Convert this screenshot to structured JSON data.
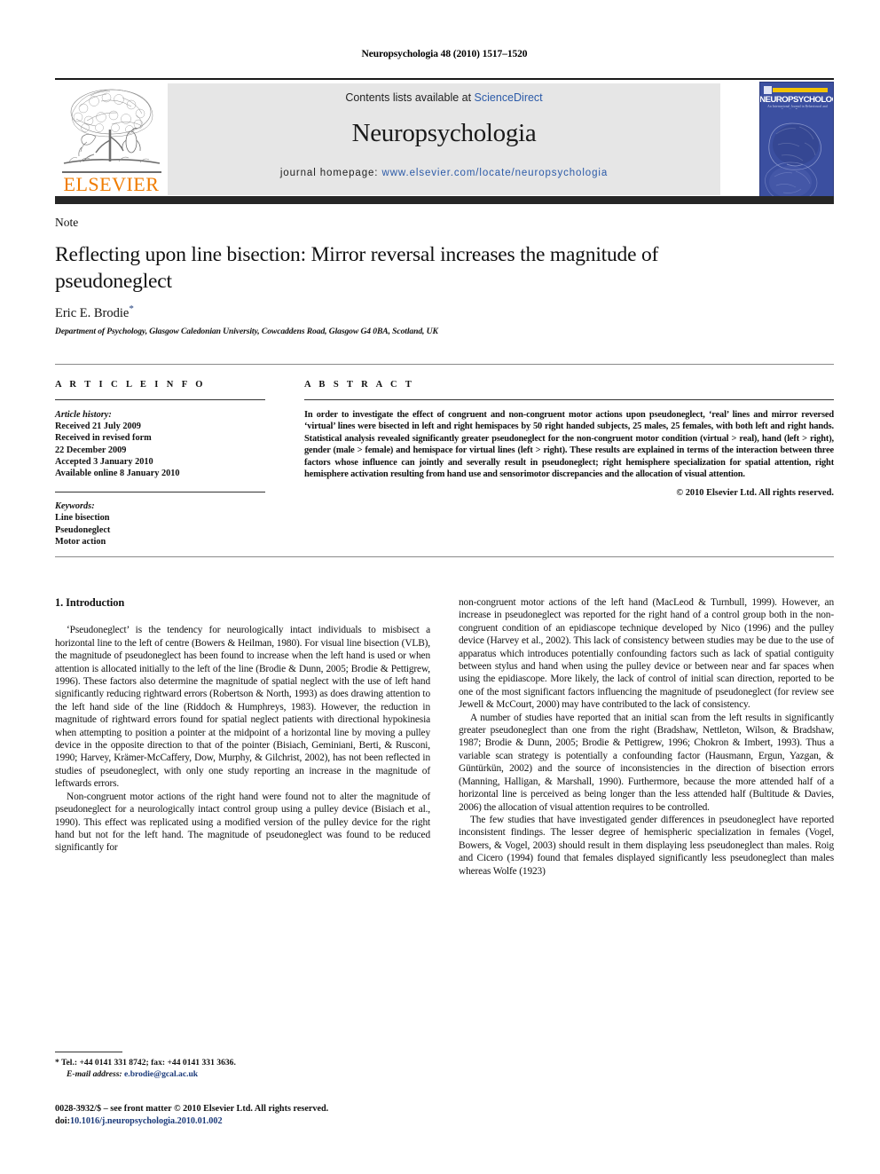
{
  "running_head": "Neuropsychologia 48 (2010) 1517–1520",
  "masthead": {
    "contents_prefix": "Contents lists available at ",
    "contents_link": "ScienceDirect",
    "journal_title": "Neuropsychologia",
    "homepage_label": "journal homepage:",
    "homepage_url": "www.elsevier.com/locate/neuropsychologia",
    "publisher_wordmark": "ELSEVIER",
    "cover": {
      "name": "NEUROPSYCHOLOGIA",
      "subtitle": "An International Journal in Behavioural and Cognitive Neuroscience"
    }
  },
  "article": {
    "section": "Note",
    "title": "Reflecting upon line bisection: Mirror reversal increases the magnitude of pseudoneglect",
    "author": "Eric E. Brodie",
    "author_marker": "*",
    "affiliation": "Department of Psychology, Glasgow Caledonian University, Cowcaddens Road, Glasgow G4 0BA, Scotland, UK"
  },
  "info": {
    "heading": "A R T I C L E   I N F O",
    "history_label": "Article history:",
    "history": [
      "Received 21 July 2009",
      "Received in revised form",
      "22 December 2009",
      "Accepted 3 January 2010",
      "Available online 8 January 2010"
    ],
    "keywords_label": "Keywords:",
    "keywords": [
      "Line bisection",
      "Pseudoneglect",
      "Motor action"
    ]
  },
  "abstract": {
    "heading": "A B S T R A C T",
    "text": "In order to investigate the effect of congruent and non-congruent motor actions upon pseudoneglect, ‘real’ lines and mirror reversed ‘virtual’ lines were bisected in left and right hemispaces by 50 right handed subjects, 25 males, 25 females, with both left and right hands. Statistical analysis revealed significantly greater pseudoneglect for the non-congruent motor condition (virtual > real), hand (left > right), gender (male > female) and hemispace for virtual lines (left > right). These results are explained in terms of the interaction between three factors whose influence can jointly and severally result in pseudoneglect; right hemisphere specialization for spatial attention, right hemisphere activation resulting from hand use and sensorimotor discrepancies and the allocation of visual attention.",
    "copyright": "© 2010 Elsevier Ltd. All rights reserved."
  },
  "body": {
    "section_number_title": "1.  Introduction",
    "left_paragraphs": [
      "‘Pseudoneglect’ is the tendency for neurologically intact individuals to misbisect a horizontal line to the left of centre (Bowers & Heilman, 1980). For visual line bisection (VLB), the magnitude of pseudoneglect has been found to increase when the left hand is used or when attention is allocated initially to the left of the line (Brodie & Dunn, 2005; Brodie & Pettigrew, 1996). These factors also determine the magnitude of spatial neglect with the use of left hand significantly reducing rightward errors (Robertson & North, 1993) as does drawing attention to the left hand side of the line (Riddoch & Humphreys, 1983). However, the reduction in magnitude of rightward errors found for spatial neglect patients with directional hypokinesia when attempting to position a pointer at the midpoint of a horizontal line by moving a pulley device in the opposite direction to that of the pointer (Bisiach, Geminiani, Berti, & Rusconi, 1990; Harvey, Krämer-McCaffery, Dow, Murphy, & Gilchrist, 2002), has not been reflected in studies of pseudoneglect, with only one study reporting an increase in the magnitude of leftwards errors.",
      "Non-congruent motor actions of the right hand were found not to alter the magnitude of pseudoneglect for a neurologically intact control group using a pulley device (Bisiach et al., 1990). This effect was replicated using a modified version of the pulley device for the right hand but not for the left hand. The magnitude of pseudoneglect was found to be reduced significantly for"
    ],
    "right_paragraphs": [
      "non-congruent motor actions of the left hand (MacLeod & Turnbull, 1999). However, an increase in pseudoneglect was reported for the right hand of a control group both in the non-congruent condition of an epidiascope technique developed by Nico (1996) and the pulley device (Harvey et al., 2002). This lack of consistency between studies may be due to the use of apparatus which introduces potentially confounding factors such as lack of spatial contiguity between stylus and hand when using the pulley device or between near and far spaces when using the epidiascope. More likely, the lack of control of initial scan direction, reported to be one of the most significant factors influencing the magnitude of pseudoneglect (for review see Jewell & McCourt, 2000) may have contributed to the lack of consistency.",
      "A number of studies have reported that an initial scan from the left results in significantly greater pseudoneglect than one from the right (Bradshaw, Nettleton, Wilson, & Bradshaw, 1987; Brodie & Dunn, 2005; Brodie & Pettigrew, 1996; Chokron & Imbert, 1993). Thus a variable scan strategy is potentially a confounding factor (Hausmann, Ergun, Yazgan, & Güntürkün, 2002) and the source of inconsistencies in the direction of bisection errors (Manning, Halligan, & Marshall, 1990). Furthermore, because the more attended half of a horizontal line is perceived as being longer than the less attended half (Bultitude & Davies, 2006) the allocation of visual attention requires to be controlled.",
      "The few studies that have investigated gender differences in pseudoneglect have reported inconsistent findings. The lesser degree of hemispheric specialization in females (Vogel, Bowers, & Vogel, 2003) should result in them displaying less pseudoneglect than males. Roig and Cicero (1994) found that females displayed significantly less pseudoneglect than males whereas Wolfe (1923)"
    ]
  },
  "footnote": {
    "marker": "*",
    "contact": "Tel.: +44 0141 331 8742; fax: +44 0141 331 3636.",
    "email_label": "E-mail address:",
    "email": "e.brodie@gcal.ac.uk"
  },
  "imprint": {
    "line1": "0028-3932/$ – see front matter © 2010 Elsevier Ltd. All rights reserved.",
    "doi_label": "doi:",
    "doi": "10.1016/j.neuropsychologia.2010.01.002"
  },
  "colors": {
    "link": "#1b3a7a",
    "sciencedirect": "#2b5aa8",
    "elsevier_orange": "#f07c00",
    "cover_blue": "#3b4fa0",
    "cover_yellow": "#f2c200",
    "panel_gray": "#e6e6e6",
    "rule_dark": "#262626"
  }
}
